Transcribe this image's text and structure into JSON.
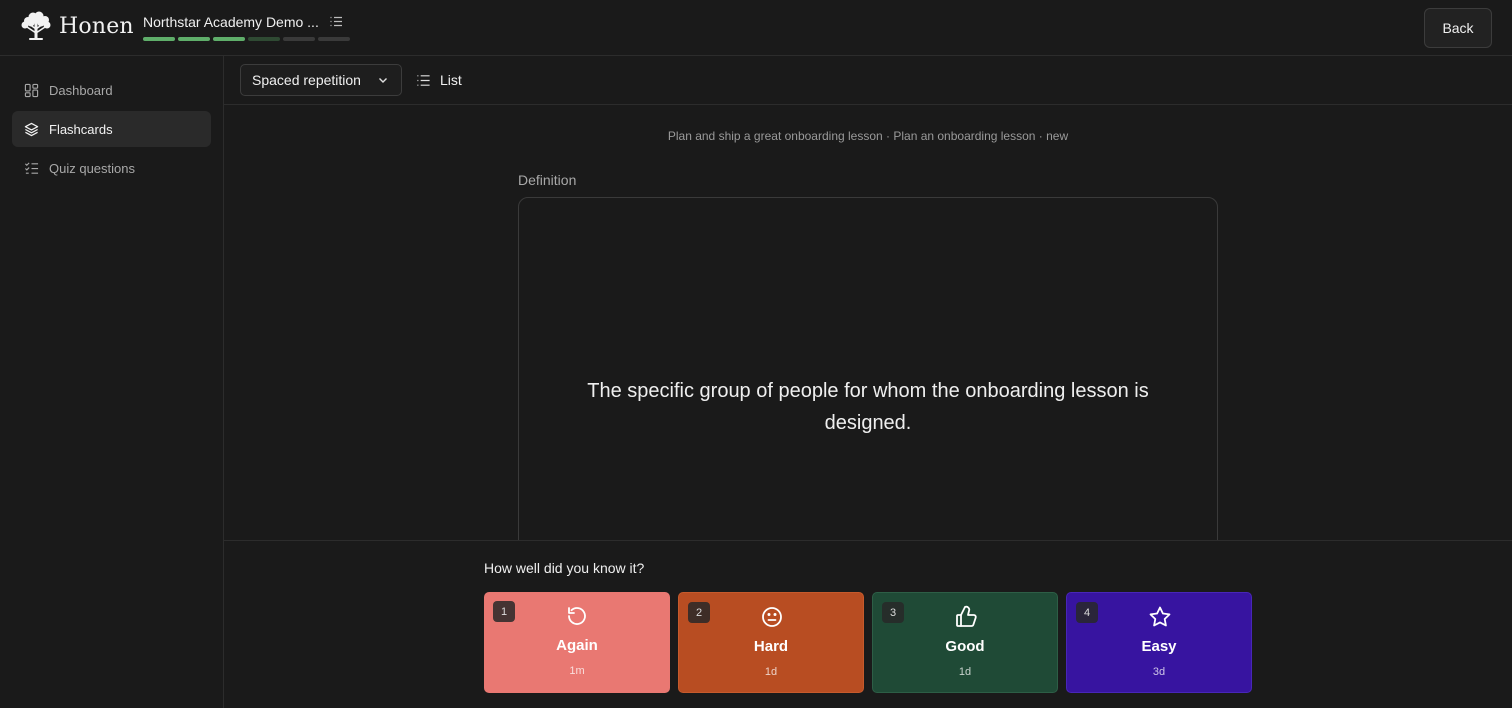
{
  "header": {
    "brand": "Honen",
    "course_title": "Northstar Academy Demo ...",
    "progress": [
      1,
      1,
      1,
      0.5,
      0,
      0
    ],
    "back_label": "Back"
  },
  "sidebar": {
    "items": [
      {
        "label": "Dashboard",
        "icon": "dashboard-icon",
        "active": false
      },
      {
        "label": "Flashcards",
        "icon": "layers-icon",
        "active": true
      },
      {
        "label": "Quiz questions",
        "icon": "checklist-icon",
        "active": false
      }
    ]
  },
  "toolbar": {
    "mode_value": "Spaced repetition",
    "list_label": "List"
  },
  "card": {
    "breadcrumb": "Plan and ship a great onboarding lesson · Plan an onboarding lesson · new",
    "side_label": "Definition",
    "text": "The specific group of people for whom the onboarding lesson is designed."
  },
  "answers": {
    "question": "How well did you know it?",
    "options": [
      {
        "key": "1",
        "label": "Again",
        "interval": "1m",
        "icon": "undo-icon",
        "color": "#e97872"
      },
      {
        "key": "2",
        "label": "Hard",
        "interval": "1d",
        "icon": "neutral-face-icon",
        "color": "#b84d22"
      },
      {
        "key": "3",
        "label": "Good",
        "interval": "1d",
        "icon": "thumbs-up-icon",
        "color": "#1f4a36"
      },
      {
        "key": "4",
        "label": "Easy",
        "interval": "3d",
        "icon": "star-icon",
        "color": "#3714a0"
      }
    ]
  }
}
